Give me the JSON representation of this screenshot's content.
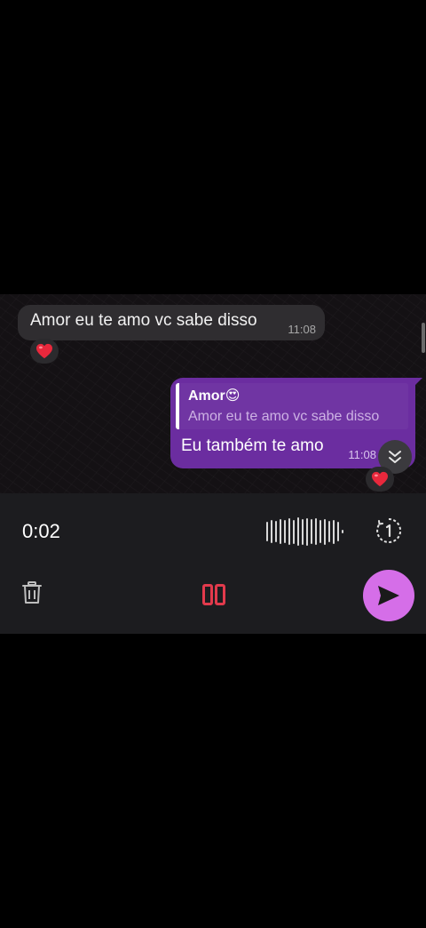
{
  "colors": {
    "outgoing_bubble": "#6b2da0",
    "incoming_bubble": "#2f2d30",
    "send_button": "#d56ee8",
    "pause_button": "#e23a4c",
    "recorder_bar": "#1c1c1f"
  },
  "messages": [
    {
      "direction": "incoming",
      "text": "Amor eu te amo vc sabe disso",
      "time": "11:08",
      "reaction_icon": "red-heart-emoji"
    },
    {
      "direction": "outgoing",
      "reply_to": {
        "author": "Amor😍",
        "text": "Amor eu te amo vc sabe disso"
      },
      "text": "Eu também te amo",
      "time": "11:08",
      "reaction_icon": "red-heart-emoji"
    }
  ],
  "scroll_down_icon": "double-chevron-down-icon",
  "recorder": {
    "elapsed": "0:02",
    "waveform_icon": "waveform-icon",
    "playback_speed_icon": "playback-speed-1x-icon",
    "delete_icon": "trash-icon",
    "pause_icon": "pause-icon",
    "send_icon": "send-icon"
  }
}
